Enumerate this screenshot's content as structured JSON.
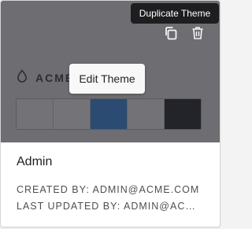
{
  "tooltips": {
    "duplicate": "Duplicate Theme",
    "edit": "Edit Theme"
  },
  "preview": {
    "brand_text": "ACME",
    "background": "#6e6e72",
    "swatches": [
      "#737377",
      "#747478",
      "#2c4b72",
      "#737377",
      "#23232a"
    ]
  },
  "actions": {
    "duplicate_icon": "copy-icon",
    "delete_icon": "trash-icon"
  },
  "theme": {
    "name": "Admin",
    "created_by": "CREATED BY: ADMIN@ACME.COM",
    "last_updated_by": "LAST UPDATED BY: ADMIN@ACME.COM"
  }
}
